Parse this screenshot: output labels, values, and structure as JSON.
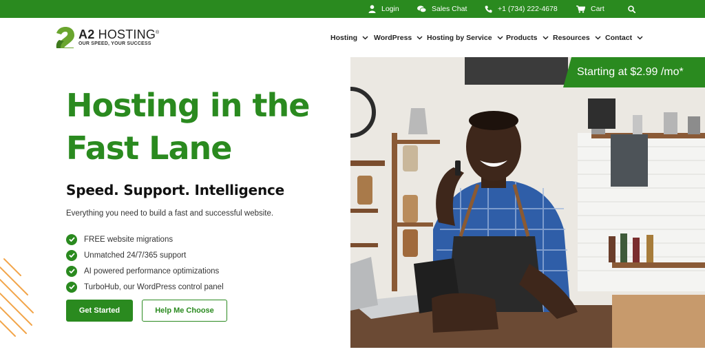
{
  "topbar": {
    "login": "Login",
    "sales_chat": "Sales Chat",
    "phone": "+1 (734) 222-4678",
    "cart": "Cart",
    "icons": [
      "user-icon",
      "chat-icon",
      "phone-icon",
      "cart-icon",
      "search-icon"
    ]
  },
  "logo": {
    "name_bold": "A2",
    "name_rest": " HOSTING",
    "registered": "®",
    "tagline": "OUR SPEED, YOUR SUCCESS"
  },
  "nav": {
    "items": [
      "Hosting",
      "WordPress",
      "Hosting by Service",
      "Products",
      "Resources",
      "Contact"
    ]
  },
  "hero": {
    "title": "Hosting in the Fast Lane",
    "subtitle": "Speed. Support. Intelligence",
    "description": "Everything you need to build a fast and successful website.",
    "features": [
      "FREE website migrations",
      "Unmatched 24/7/365 support",
      "AI powered performance optimizations",
      "TurboHub, our WordPress control panel"
    ],
    "primary_button": "Get Started",
    "secondary_button": "Help Me Choose",
    "price_badge": "Starting at $2.99 /mo*"
  },
  "colors": {
    "brand_green": "#2a8a1f",
    "accent_orange": "#f2a54a"
  }
}
